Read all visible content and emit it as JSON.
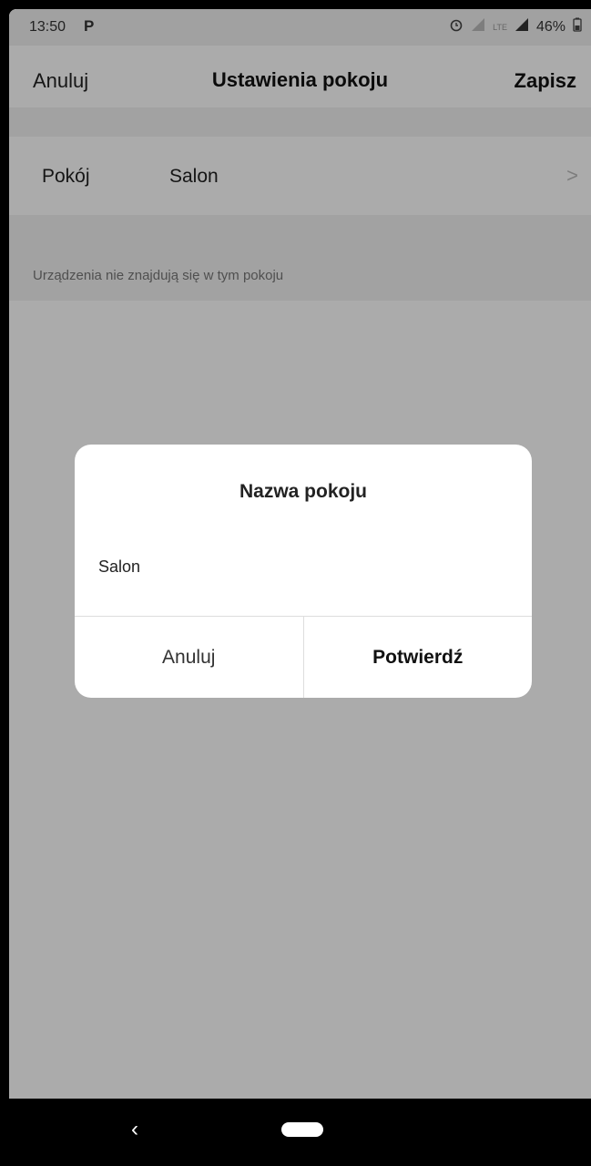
{
  "status_bar": {
    "time": "13:50",
    "app_indicator": "P",
    "battery": "46%",
    "network": "LTE",
    "icons": [
      "alarm-icon",
      "signal-icon",
      "lte-icon",
      "signal-icon",
      "battery-icon"
    ]
  },
  "header": {
    "cancel_label": "Anuluj",
    "title": "Ustawienia pokoju",
    "save_label": "Zapisz"
  },
  "room_row": {
    "label": "Pokój",
    "value": "Salon",
    "chevron": ">"
  },
  "info_text": "Urządzenia nie znajdują się w tym pokoju",
  "dialog": {
    "title": "Nazwa pokoju",
    "input_value": "Salon",
    "cancel_label": "Anuluj",
    "confirm_label": "Potwierdź"
  },
  "nav_bar": {
    "back_glyph": "‹"
  },
  "colors": {
    "overlay": "#000000",
    "background": "#ffffff",
    "section_gap": "#f2f2f2",
    "navbar": "#000000"
  }
}
